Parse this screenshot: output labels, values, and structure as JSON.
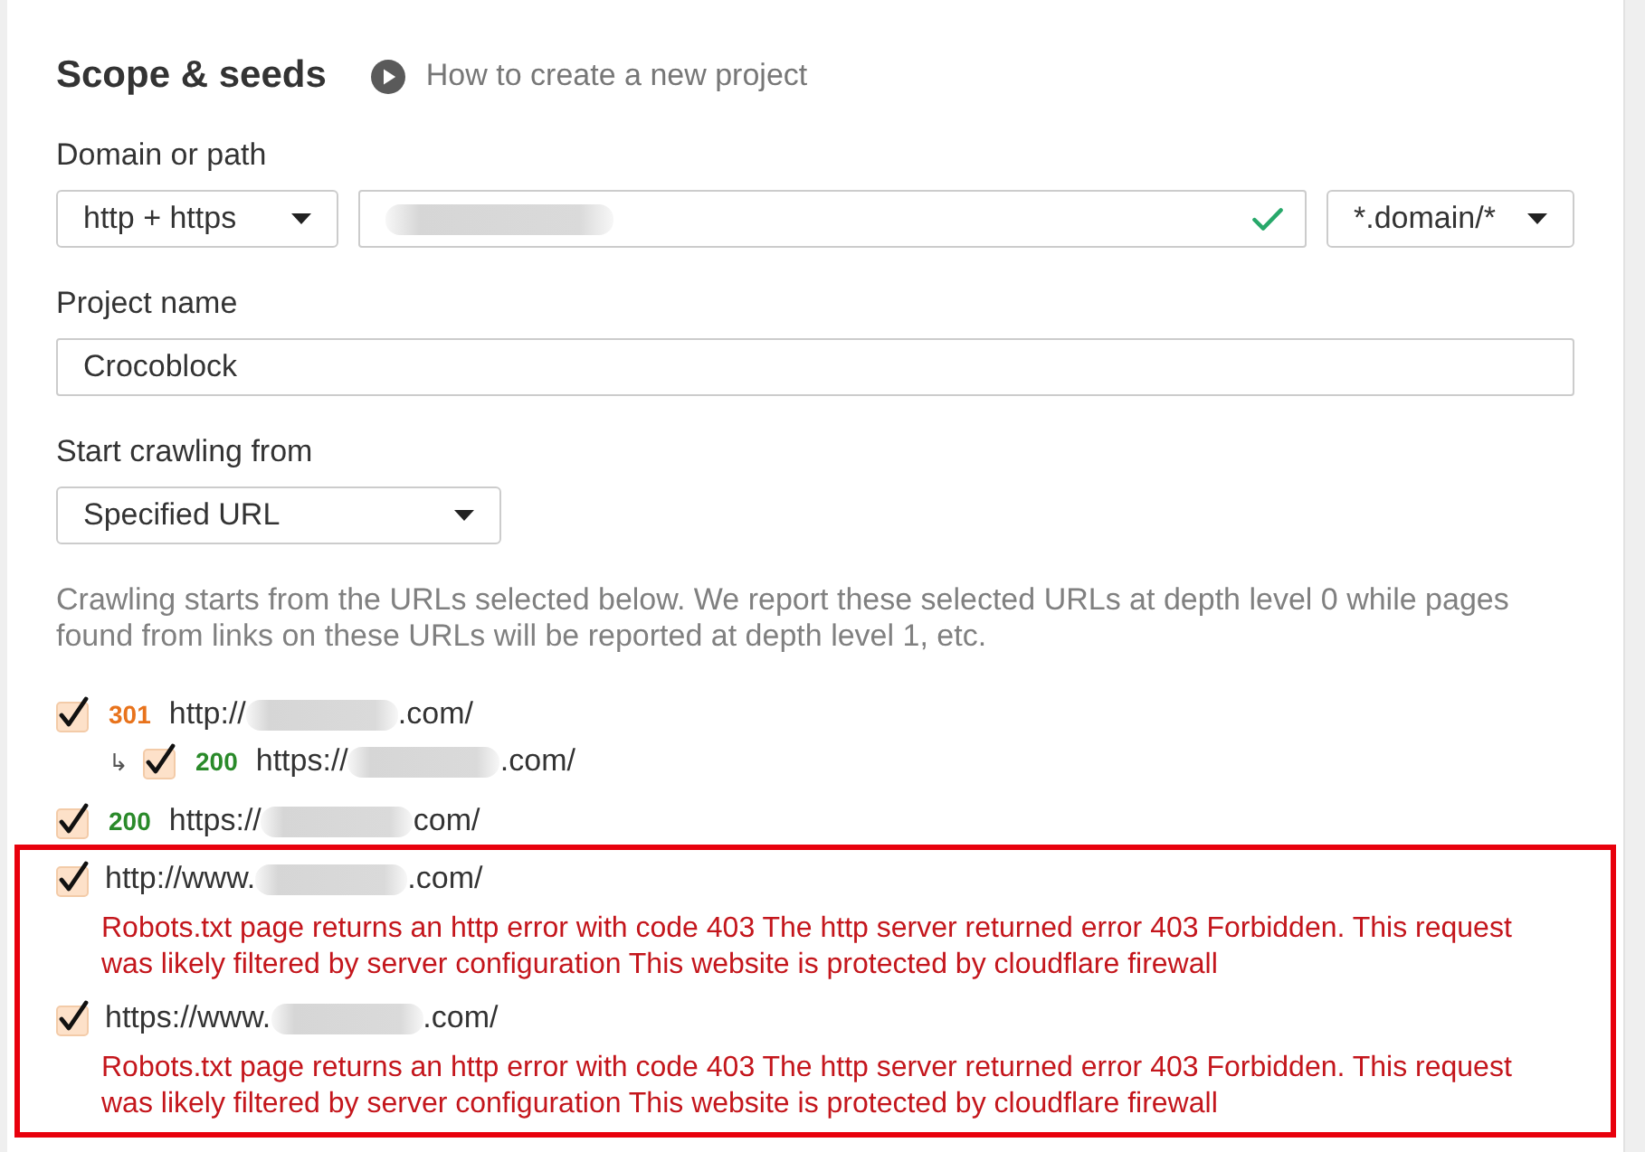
{
  "section": {
    "title": "Scope & seeds",
    "help_link": "How to create a new project"
  },
  "domain": {
    "label": "Domain or path",
    "protocol": "http + https",
    "valid": true,
    "scope": "*.domain/*"
  },
  "project_name": {
    "label": "Project name",
    "value": "Crocoblock"
  },
  "start_crawling": {
    "label": "Start crawling from",
    "value": "Specified URL"
  },
  "note": "Crawling starts from the URLs selected below. We report these selected URLs at depth level 0 while pages found from links on these URLs will be reported at depth level 1, etc.",
  "urls": [
    {
      "checked": true,
      "status": "301",
      "color": "#e8731c",
      "prefix": "http://",
      "suffix": ".com/",
      "children": [
        {
          "marker": "↳",
          "checked": true,
          "status": "200",
          "color": "#2a8a2a",
          "prefix": "https://",
          "suffix": ".com/"
        }
      ]
    },
    {
      "checked": true,
      "status": "200",
      "color": "#2a8a2a",
      "prefix": "https://",
      "suffix": "com/"
    }
  ],
  "highlighted_urls": [
    {
      "checked": true,
      "prefix": "http://www.",
      "suffix": ".com/",
      "error": "Robots.txt page returns an http error with code 403 The http server returned error 403 Forbidden. This request was likely filtered by server configuration This website is protected by cloudflare firewall"
    },
    {
      "checked": true,
      "prefix": "https://www.",
      "suffix": ".com/",
      "error": "Robots.txt page returns an http error with code 403 The http server returned error 403 Forbidden. This request was likely filtered by server configuration This website is protected by cloudflare firewall"
    }
  ]
}
